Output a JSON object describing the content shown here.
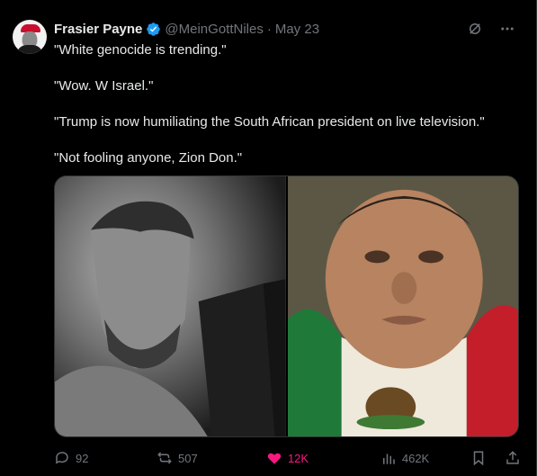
{
  "author": {
    "name": "Frasier Payne",
    "handle": "@MeinGottNiles",
    "separator": "·",
    "date": "May 23"
  },
  "colors": {
    "background": "#000000",
    "text": "#e7e9ea",
    "muted": "#71767b",
    "verified": "#1d9bf0",
    "like": "#f91880"
  },
  "icons": {
    "verified": "verified-badge-icon",
    "grok": "grok-icon",
    "more": "more-icon",
    "reply": "reply-icon",
    "retweet": "retweet-icon",
    "like": "heart-icon",
    "views": "views-icon",
    "bookmark": "bookmark-icon",
    "share": "share-icon"
  },
  "tweet_text": {
    "p1": "\"White genocide is trending.\"",
    "p2": "\"Wow. W Israel.\"",
    "p3": "\"Trump is now humiliating the South African president on live television.\"",
    "p4": "\"Not fooling anyone, Zion Don.\""
  },
  "media": {
    "left_image": "left-photo",
    "right_image": "right-photo"
  },
  "stats": {
    "replies": "92",
    "retweets": "507",
    "likes": "12K",
    "views": "462K"
  }
}
